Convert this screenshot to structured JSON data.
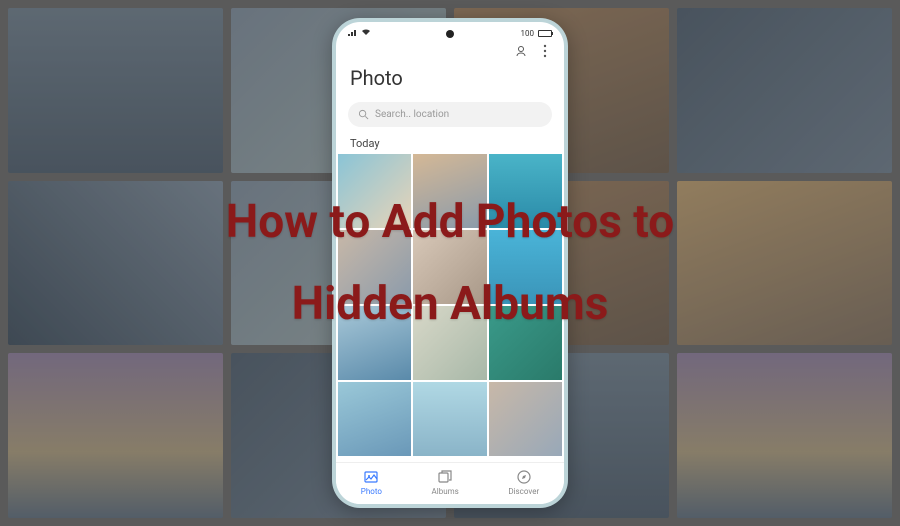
{
  "overlay": {
    "line1": "How to Add Photos to",
    "line2": "Hidden Albums"
  },
  "phone": {
    "status": {
      "battery_label": "100"
    },
    "app": {
      "title": "Photo",
      "search_placeholder": "Search.. location",
      "section_label": "Today"
    },
    "nav": {
      "items": [
        {
          "label": "Photo",
          "icon": "photo-icon",
          "active": true
        },
        {
          "label": "Albums",
          "icon": "albums-icon",
          "active": false
        },
        {
          "label": "Discover",
          "icon": "discover-icon",
          "active": false
        }
      ]
    }
  }
}
